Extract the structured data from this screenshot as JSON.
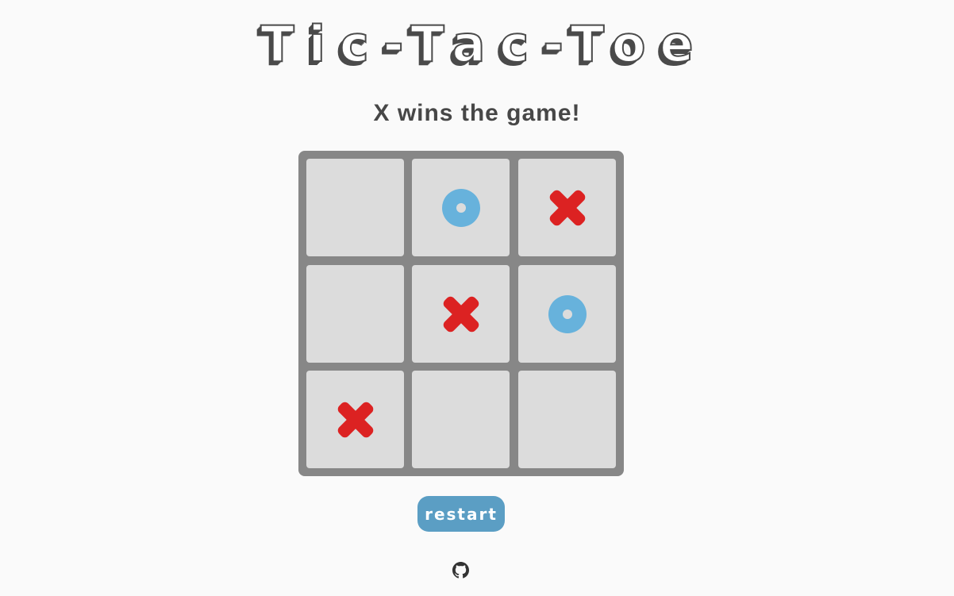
{
  "title": "Tic-Tac-Toe",
  "status": "X wins the game!",
  "board": [
    [
      "",
      "O",
      "X"
    ],
    [
      "",
      "X",
      "O"
    ],
    [
      "X",
      "",
      ""
    ]
  ],
  "restart_label": "restart",
  "footer": {
    "icon": "github-icon"
  },
  "colors": {
    "background": "#fafafa",
    "board_frame": "#878787",
    "cell": "#dcdcdc",
    "x_mark": "#dc2222",
    "o_mark": "#67b2dc",
    "restart_button": "#5b9ec4",
    "text": "#474747"
  }
}
